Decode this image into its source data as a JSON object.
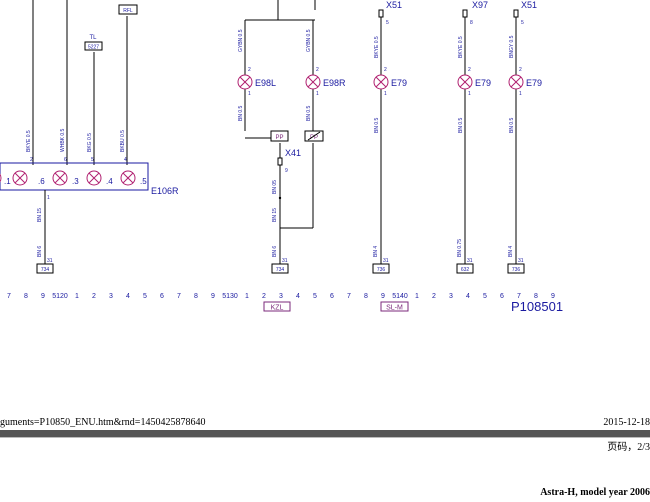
{
  "diagram": {
    "colors": {
      "line": "#000000",
      "blue": "#1a1aa0",
      "purple": "#7b2a7b",
      "lamp": "#b02070"
    },
    "top_connectors": {
      "x51_a": "X51",
      "x97": "X97",
      "x51_b": "X51"
    },
    "top_pins": {
      "p5a": "5",
      "p8": "8",
      "p5b": "5"
    },
    "wires_top": {
      "w1": "BKYE 0.5",
      "w2": "BKYE 0.5",
      "w3": "BNGY 0.5"
    },
    "lamps": [
      {
        "id": "E98L",
        "wire_top": "GYBN 0.5",
        "wire_bottom": "BN 0.5",
        "pin_top": "2",
        "pin_bottom": "1"
      },
      {
        "id": "E98R",
        "wire_top": "GYBN 0.5",
        "wire_bottom": "BN 0.5",
        "pin_top": "2",
        "pin_bottom": "1"
      },
      {
        "id": "E79",
        "wire_bottom": "BN 0.5",
        "pin_top": "2",
        "pin_bottom": "1"
      },
      {
        "id": "E79",
        "wire_bottom": "BN 0.5",
        "pin_top": "2",
        "pin_bottom": "1"
      },
      {
        "id": "E79",
        "wire_bottom": "BN 0.5",
        "pin_top": "2",
        "pin_bottom": "1"
      }
    ],
    "module": {
      "id": "E106R",
      "lamps": [
        ".1",
        ".6",
        ".3",
        ".4",
        ".5"
      ],
      "pins": [
        "2",
        "6",
        "5",
        "4"
      ],
      "wires": [
        "BKYE 0.5",
        "WHBK 0.5",
        "BKG 0.5",
        "BKBU 0.5"
      ],
      "labels": {
        "tl": "TL",
        "tl_ref": "5227",
        "rfl": "RFL"
      },
      "out_pin": "1",
      "out_wire": "BN 15",
      "out_wire2": "BN 6"
    },
    "switch_block": {
      "left_label": "PP",
      "right_label": "PP",
      "connector": "X41",
      "pin": "9",
      "wire1": "BN 05",
      "wire2": "BN 15",
      "wire3": "BN 6"
    },
    "grounds": [
      {
        "pin": "31",
        "ref": "734"
      },
      {
        "pin": "31",
        "ref": "734"
      },
      {
        "pin": "31",
        "ref": "736"
      },
      {
        "pin": "31",
        "ref": "632"
      },
      {
        "pin": "31",
        "ref": "736"
      }
    ],
    "ground_wires": {
      "g3": "BN 4",
      "g4": "BN 0.75",
      "g5": "BN 4"
    },
    "ruler": [
      "7",
      "8",
      "9",
      "5120",
      "1",
      "2",
      "3",
      "4",
      "5",
      "6",
      "7",
      "8",
      "9",
      "5130",
      "1",
      "2",
      "3",
      "4",
      "5",
      "6",
      "7",
      "8",
      "9",
      "5140",
      "1",
      "2",
      "3",
      "4",
      "5",
      "6",
      "7",
      "8",
      "9"
    ],
    "zone_tags": {
      "kzl": "KZL",
      "slm": "SL-M"
    },
    "page_ref": "P108501"
  },
  "footer": {
    "url": "guments=P10850_ENU.htm&rnd=1450425878640",
    "date": "2015-12-18",
    "page": "页码，2/3",
    "model": "Astra-H, model year 2006"
  }
}
